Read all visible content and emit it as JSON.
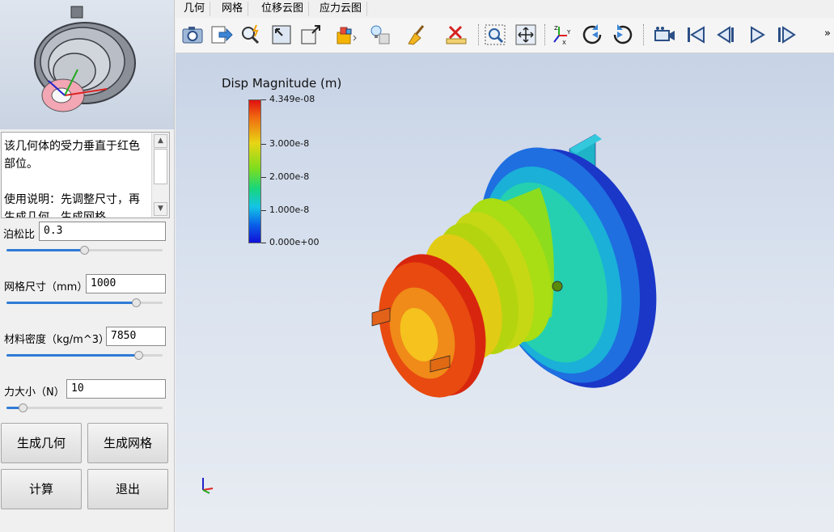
{
  "menu": {
    "items": [
      "几何",
      "网格",
      "位移云图",
      "应力云图"
    ]
  },
  "toolbar": {
    "icons": [
      "camera-icon",
      "export-icon",
      "zoom-select-icon",
      "fit-view-icon",
      "view-cube-icon",
      "layers-icon",
      "light-icon",
      "clean-icon",
      "delete-measure-icon",
      "zoom-box-icon",
      "pan-icon",
      "axes-icon",
      "rotate-cw-icon",
      "rotate-ccw-icon",
      "camera-record-icon",
      "first-frame-icon",
      "prev-frame-icon",
      "play-icon",
      "last-frame-icon"
    ],
    "more": "»"
  },
  "description": {
    "text": "该几何体的受力垂直于红色部位。\n\n使用说明：先调整尺寸，再生成几何、生成网格、"
  },
  "params": {
    "poisson": {
      "label": "泊松比",
      "value": "0.3",
      "slider_fraction": 0.5
    },
    "mesh": {
      "label": "网格尺寸（mm）",
      "value": "1000",
      "slider_fraction": 0.85
    },
    "density": {
      "label": "材料密度（kg/m^3）",
      "value": "7850",
      "slider_fraction": 0.87
    },
    "force": {
      "label": "力大小（N）",
      "value": "10",
      "slider_fraction": 0.08
    }
  },
  "buttons": {
    "gen_geometry": "生成几何",
    "gen_mesh": "生成网格",
    "compute": "计算",
    "exit": "退出"
  },
  "legend": {
    "title": "Disp Magnitude (m)",
    "ticks": [
      "4.349e-08",
      "3.000e-8",
      "2.000e-8",
      "1.000e-8",
      "0.000e+00"
    ]
  },
  "colors": {
    "slider_fill": "#2f7bd6",
    "high": "#e01010",
    "low": "#1010d8"
  }
}
